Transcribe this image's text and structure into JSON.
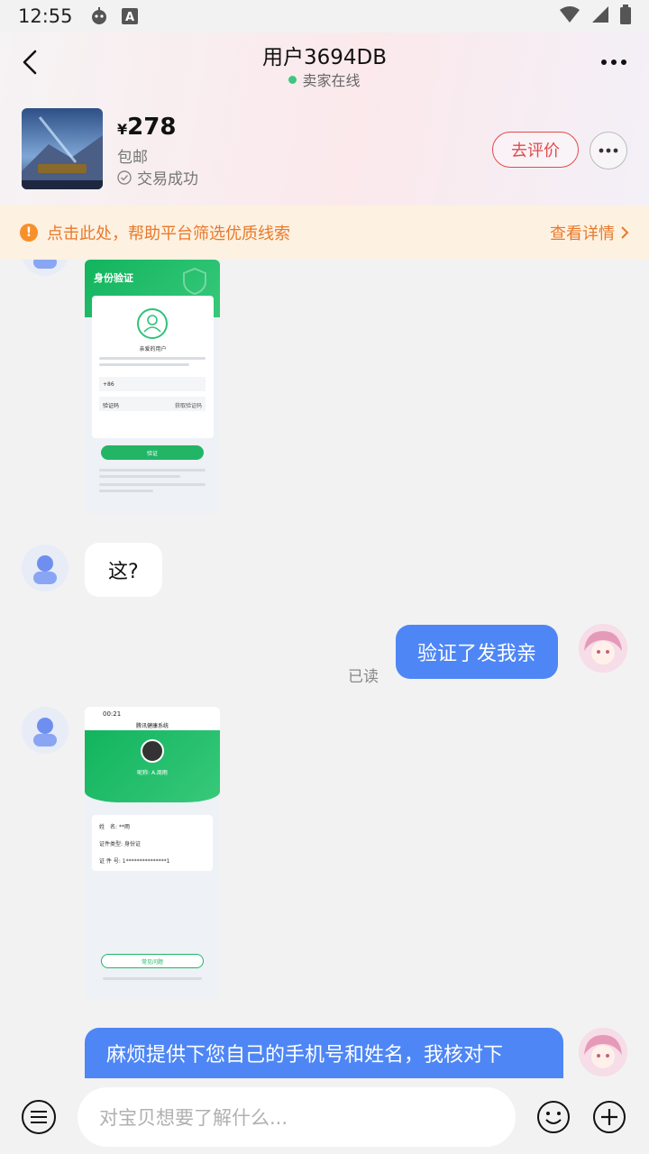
{
  "status_bar": {
    "time": "12:55"
  },
  "header": {
    "title": "用户3694DB",
    "online_status": "卖家在线",
    "price_currency": "¥",
    "price_value": "278",
    "shipping": "包邮",
    "trade_status": "交易成功",
    "review_button": "去评价"
  },
  "notice": {
    "text": "点击此处，帮助平台筛选优质线索",
    "details_label": "查看详情"
  },
  "messages": {
    "m1_text": "这?",
    "m2_text": "验证了发我亲",
    "m2_read": "已读",
    "m3_text": "麻烦提供下您自己的手机号和姓名，我核对下"
  },
  "shot1": {
    "title": "身份验证",
    "caption": "亲爱的用户",
    "phone_prefix": "+86",
    "code_label": "验证码",
    "get_code": "获取验证码",
    "button": "验证"
  },
  "shot2": {
    "time": "00:21",
    "app_title": "腾讯健康系统",
    "nickname": "昵称: A.周雨",
    "name_label": "姓　名:",
    "name_value": "**雨",
    "id_type_label": "证件类型:",
    "id_type_value": "身份证",
    "id_no_label": "证 件 号:",
    "id_no_value": "1***************1",
    "faq_button": "常见问题"
  },
  "input": {
    "placeholder": "对宝贝想要了解什么..."
  },
  "colors": {
    "accent_blue": "#4e86f5",
    "review_red": "#e24a4a",
    "notice_orange": "#e9792a",
    "online_green": "#3fc77d"
  }
}
